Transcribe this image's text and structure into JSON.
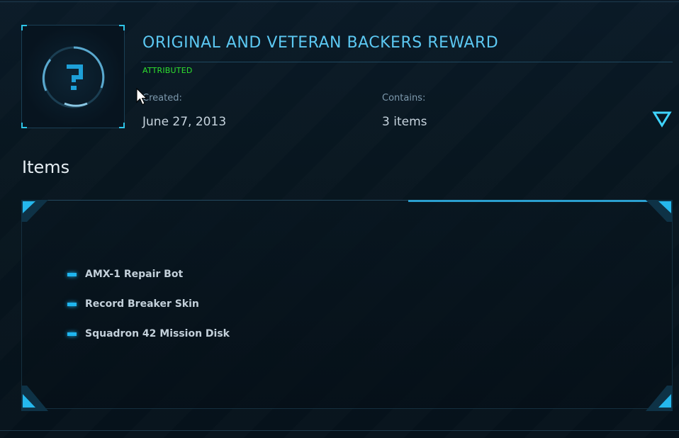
{
  "pledge": {
    "title": "ORIGINAL AND VETERAN BACKERS REWARD",
    "status": "ATTRIBUTED",
    "created_label": "Created:",
    "created_value": "June 27, 2013",
    "contains_label": "Contains:",
    "contains_value": "3 items",
    "thumbnail_icon": "question-mark-icon",
    "expand_icon": "chevron-down-icon"
  },
  "items_section": {
    "title": "Items",
    "items": [
      {
        "label": "AMX-1 Repair Bot"
      },
      {
        "label": "Record Breaker Skin"
      },
      {
        "label": "Squadron 42 Mission Disk"
      }
    ]
  },
  "colors": {
    "accent": "#5cc8f2",
    "status_green": "#2fe02f",
    "bullet": "#1fb6f0",
    "background": "#07141f"
  }
}
